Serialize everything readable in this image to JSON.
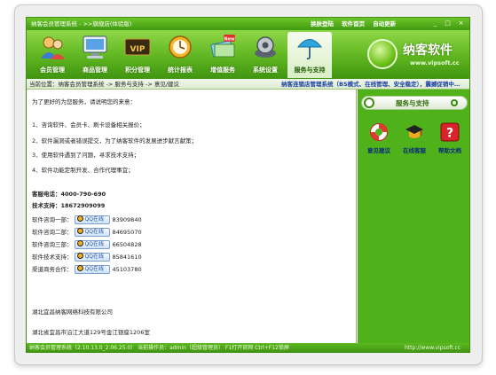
{
  "titlebar": {
    "title": "纳客会员管理系统 - >>旗舰店(体验版)",
    "links": [
      "换肤登陆",
      "软件首页",
      "自动更新"
    ],
    "min_label": "_",
    "max_label": "□",
    "close_label": "×"
  },
  "toolbar": {
    "items": [
      {
        "label": "会员管理",
        "icon": "members-icon"
      },
      {
        "label": "商品管理",
        "icon": "computer-icon"
      },
      {
        "label": "积分管理",
        "icon": "vip-card-icon"
      },
      {
        "label": "统计报表",
        "icon": "clock-chart-icon"
      },
      {
        "label": "增值服务",
        "icon": "new-money-icon"
      },
      {
        "label": "系统设置",
        "icon": "gears-icon"
      },
      {
        "label": "服务与支持",
        "icon": "umbrella-icon"
      }
    ],
    "vip_text": "VIP",
    "new_badge": "New"
  },
  "logo": {
    "name": "纳客软件",
    "url": "www.vipsoft.cc"
  },
  "breadcrumb": {
    "path": "当前位置：纳客会员管理系统 -> 服务与支持 -> 意见/建议",
    "marquee": "纳客连锁店管理系统（BS模式、在线管理、安全稳定），震撼促销中…"
  },
  "content": {
    "intro": "为了更好的为您服务，请说明您的来意：",
    "reasons": [
      "1、咨询软件、会员卡、刷卡设备相关报价；",
      "2、软件漏洞或者错误提交，为了纳客软件的发展进步献言献策；",
      "3、使用软件遇到了问题，寻求技术支持；",
      "4、软件功能定制开发、合作代理事宜；"
    ],
    "phone": "客服电话：4000-790-690",
    "tech_phone": "技术支持：18672909099",
    "qq_button_label": "QQ在线",
    "qq_rows": [
      {
        "label": "软件咨询一部：",
        "number": "83909840"
      },
      {
        "label": "软件咨询二部：",
        "number": "84695070"
      },
      {
        "label": "软件咨询三部：",
        "number": "66504828"
      },
      {
        "label": "软件技术支持：",
        "number": "85841610"
      },
      {
        "label": "渠道商务合作：",
        "number": "45103780"
      }
    ],
    "company": "湖北宜昌纳客网络科技有限公司",
    "address": "湖北省宜昌市沿江大道129号金江银座1206室"
  },
  "side": {
    "header": "服务与支持",
    "buttons": [
      {
        "label": "意见建议",
        "icon": "lifebuoy-icon"
      },
      {
        "label": "在线客服",
        "icon": "graduation-cap-icon"
      },
      {
        "label": "帮助文档",
        "icon": "help-question-icon"
      }
    ]
  },
  "status": {
    "left": "纳客会员管理系统（2.10.13.0_2.06.25.0） 当前操作员：admin（超级管理员） F1打开官网 Ctrl+F12锁屏",
    "right": "http://www.vipsoft.cc"
  }
}
